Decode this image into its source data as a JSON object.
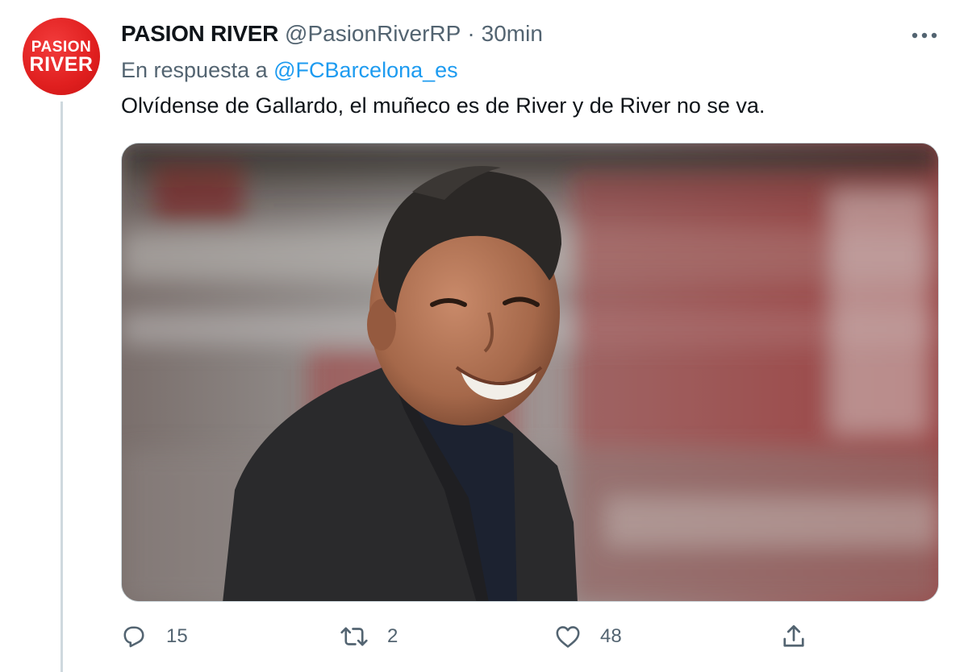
{
  "author": {
    "avatar_line1": "PASION",
    "avatar_line2": "RIVER",
    "name": "PASION RIVER",
    "handle": "@PasionRiverRP",
    "separator": "·",
    "time": "30min"
  },
  "reply": {
    "prefix": "En respuesta a",
    "mention": "@FCBarcelona_es"
  },
  "tweet_text": "Olvídense de Gallardo, el muñeco es de River y de River no se va.",
  "actions": {
    "replies": "15",
    "retweets": "2",
    "likes": "48"
  },
  "icons": {
    "more": "more-horizontal-icon",
    "reply": "reply-bubble-icon",
    "retweet": "retweet-icon",
    "like": "heart-icon",
    "share": "share-upload-icon"
  },
  "colors": {
    "brand_red": "#e01f1f",
    "link_blue": "#1d9bf0",
    "secondary_text": "#536471",
    "primary_text": "#0f1419"
  }
}
